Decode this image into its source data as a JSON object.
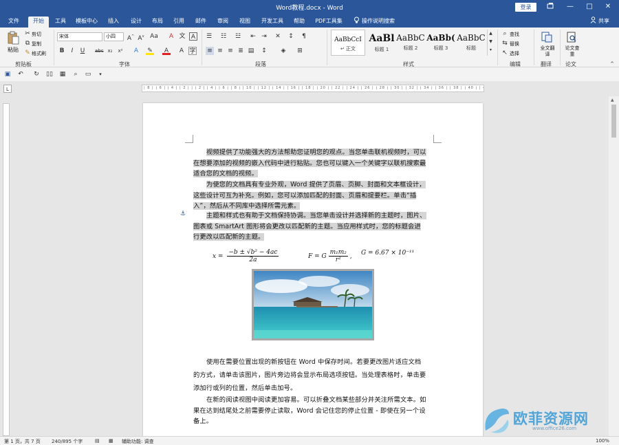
{
  "window": {
    "title": "Word教程.docx  -  Word",
    "login_label": "登录",
    "minimize": "—",
    "maximize": "□",
    "close": "✕",
    "restore_icon": "restore-icon"
  },
  "tabs": [
    {
      "label": "文件"
    },
    {
      "label": "开始"
    },
    {
      "label": "工具"
    },
    {
      "label": "模板中心"
    },
    {
      "label": "插入"
    },
    {
      "label": "设计"
    },
    {
      "label": "布局"
    },
    {
      "label": "引用"
    },
    {
      "label": "邮件"
    },
    {
      "label": "审阅"
    },
    {
      "label": "视图"
    },
    {
      "label": "开发工具"
    },
    {
      "label": "帮助"
    },
    {
      "label": "PDF工具集"
    },
    {
      "label": "操作说明搜索"
    }
  ],
  "active_tab": "开始",
  "share_label": "共享",
  "ribbon": {
    "clipboard": {
      "paste": "粘贴",
      "cut": "剪切",
      "copy": "复制",
      "format_painter": "格式刷",
      "group": "剪贴板"
    },
    "font": {
      "name": "宋体",
      "size": "小四",
      "group": "字体"
    },
    "paragraph": {
      "group": "段落"
    },
    "styles": {
      "group": "样式",
      "items": [
        {
          "sample": "AaBbCcI",
          "name": "↵ 正文"
        },
        {
          "sample": "AaBl",
          "name": "标题 1"
        },
        {
          "sample": "AaBbC",
          "name": "标题 2"
        },
        {
          "sample": "AaBb(",
          "name": "标题 3"
        },
        {
          "sample": "AaBbC",
          "name": "标题"
        }
      ]
    },
    "editing": {
      "find": "查找",
      "replace": "替换",
      "select": "选择",
      "group": "编辑"
    },
    "translate": {
      "button": "全文翻译",
      "group": "翻译"
    },
    "paper": {
      "button": "论文查重",
      "group": "论文"
    }
  },
  "ruler_text": "| 8 |  | 6 |  | 4 |  | 2 |  |  | 2 |  | 4 |  | 6 |  | 8 |  | 10 |  | 12 |  | 14 |  | 16 |  | 18 |  | 20 |  | 22 |  | 24 |  | 26 |  | 28 |  | 30 |  | 32 |  | 34 |  | 36 |  | 38 |  | 40 |  | 42",
  "document": {
    "paragraphs": [
      "视频提供了功能强大的方法帮助您证明您的观点。当您单击联机视频时，可以在想要添加的视频的嵌入代码中进行粘贴。您也可以键入一个关键字以联机搜索最适合您的文档的视频。",
      "为使您的文档具有专业外观，Word 提供了页眉、页脚、封面和文本框设计，这些设计可互为补充。例如，您可以添加匹配的封面、页眉和提要栏。单击“插入”，然后从不同库中选择所需元素。",
      "主题和样式也有助于文档保持协调。当您单击设计并选择新的主题时，图片、图表或 SmartArt 图形将会更改以匹配新的主题。当应用样式时，您的标题会进行更改以匹配新的主题。",
      "使用在需要位置出现的新按钮在 Word 中保存时间。若要更改图片适应文档的方式，请单击该图片，图片旁边将会显示布局选项按钮。当处理表格时，单击要添加行或列的位置，然后单击加号。",
      "在新的阅读视图中阅读更加容易。可以折叠文档某些部分并关注所需文本。如果在达到结尾处之前需要停止读取，Word 会记住您的停止位置 - 即使在另一个设备上。"
    ],
    "equation1": {
      "lhs": "x =",
      "numerator": "−b ± √b² − 4ac",
      "denominator": "2a"
    },
    "equation2": {
      "lhs": "F = G",
      "numerator": "m₁m₂",
      "denominator": "r²",
      "tail": ","
    },
    "equation3": "G = 6.67 × 10⁻¹¹"
  },
  "status": {
    "page": "第 1 页，共 7 页",
    "words": "240/895 个字",
    "accessibility": "辅助功能: 调查",
    "zoom": "100%"
  },
  "watermark": {
    "text": "欧菲资源网",
    "url": "www.office26.com"
  },
  "colors": {
    "accent": "#2b579a",
    "highlight": "#d5d5d5",
    "watermark": "#3f9fd8"
  }
}
